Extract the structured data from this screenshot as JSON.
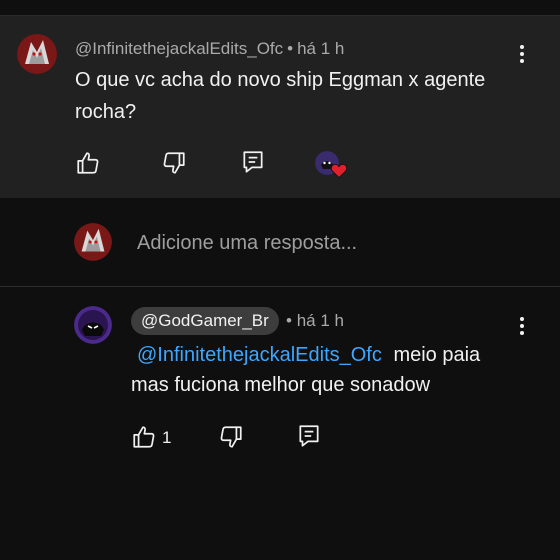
{
  "comment": {
    "author": "@InfinitethejackalEdits_Ofc",
    "separator": "•",
    "time": "há 1 h",
    "text": "O que vc acha do novo ship Eggman x agente rocha?"
  },
  "reply_input": {
    "placeholder": "Adicione uma resposta..."
  },
  "reply": {
    "author": "@GodGamer_Br",
    "separator": "•",
    "time": "há 1 h",
    "mention": "@InfinitethejackalEdits_Ofc",
    "text_after_mention": "meio paia",
    "text_line2": "mas fuciona melhor que sonadow",
    "like_count": "1"
  },
  "colors": {
    "background": "#0f0f0f",
    "card": "#212121",
    "mention": "#3ea6ff",
    "heart": "#e0202a"
  }
}
